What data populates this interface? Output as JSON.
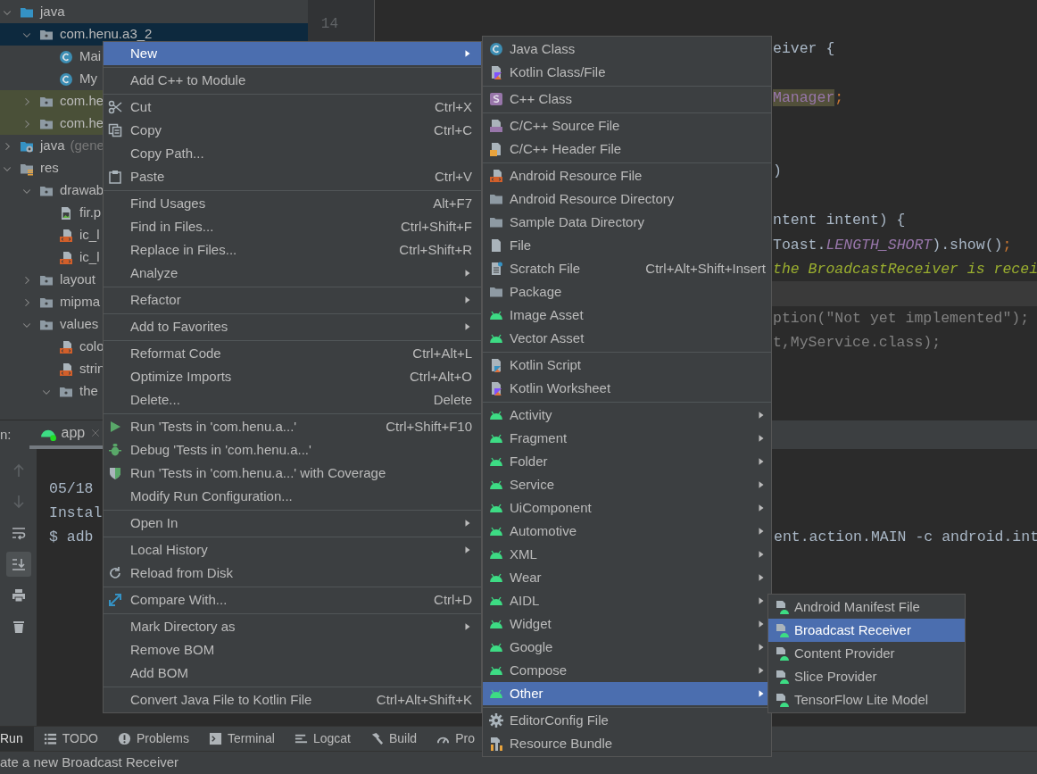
{
  "project_tree": {
    "items": [
      {
        "label": "java",
        "kind": "source-folder",
        "expanded": true,
        "selected": false,
        "tinted": false,
        "children": [
          {
            "label": "com.henu.a3_2",
            "kind": "package",
            "expanded": true,
            "selected": true,
            "tinted": false,
            "children": [
              {
                "label": "Mai",
                "kind": "class",
                "selected": false,
                "tinted": false
              },
              {
                "label": "My",
                "kind": "class",
                "selected": false,
                "tinted": false
              }
            ]
          },
          {
            "label": "com.he",
            "kind": "package",
            "expanded": false,
            "selected": false,
            "tinted": true
          },
          {
            "label": "com.he",
            "kind": "package",
            "expanded": false,
            "selected": false,
            "tinted": true
          }
        ]
      },
      {
        "label": "java",
        "note": "(gene",
        "kind": "generated-folder",
        "expanded": false,
        "selected": false,
        "tinted": false
      },
      {
        "label": "res",
        "kind": "res-folder",
        "expanded": true,
        "selected": false,
        "tinted": false,
        "children": [
          {
            "label": "drawab",
            "kind": "package",
            "expanded": true,
            "selected": false,
            "tinted": false,
            "children": [
              {
                "label": "fir.p",
                "kind": "image",
                "selected": false,
                "tinted": false
              },
              {
                "label": "ic_l",
                "kind": "xml",
                "selected": false,
                "tinted": false
              },
              {
                "label": "ic_l",
                "kind": "xml",
                "selected": false,
                "tinted": false
              }
            ]
          },
          {
            "label": "layout",
            "kind": "package",
            "expanded": false,
            "selected": false,
            "tinted": false
          },
          {
            "label": "mipma",
            "kind": "package",
            "expanded": false,
            "selected": false,
            "tinted": false
          },
          {
            "label": "values",
            "kind": "package",
            "expanded": true,
            "selected": false,
            "tinted": false,
            "children": [
              {
                "label": "colo",
                "kind": "xml",
                "selected": false,
                "tinted": false
              },
              {
                "label": "strin",
                "kind": "xml",
                "selected": false,
                "tinted": false
              },
              {
                "label": "the",
                "kind": "package",
                "expanded": true,
                "selected": false,
                "tinted": false
              }
            ]
          }
        ]
      }
    ]
  },
  "editor": {
    "lines": [
      {
        "number": "14",
        "current": false
      },
      {
        "current": false,
        "segments": [
          {
            "text": "eiver {",
            "kind": "plain"
          }
        ]
      },
      {
        "current": false
      },
      {
        "current": false,
        "segments": [
          {
            "text": "Manager",
            "kind": "marked"
          },
          {
            "text": ";",
            "kind": "keyword"
          }
        ]
      },
      {
        "current": false
      },
      {
        "current": false
      },
      {
        "current": false,
        "segments": [
          {
            "text": ")",
            "kind": "plain"
          }
        ]
      },
      {
        "current": false
      },
      {
        "current": false,
        "segments": [
          {
            "text": "ntent intent) {",
            "kind": "plain"
          }
        ]
      },
      {
        "current": false,
        "segments": [
          {
            "text": "Toast.",
            "kind": "plain"
          },
          {
            "text": "LENGTH_SHORT",
            "kind": "constant"
          },
          {
            "text": ").show()",
            "kind": "plain"
          },
          {
            "text": ";",
            "kind": "keyword"
          }
        ]
      },
      {
        "current": false,
        "segments": [
          {
            "text": "the BroadcastReceiver is recei",
            "kind": "comment"
          }
        ]
      },
      {
        "current": true
      },
      {
        "current": false,
        "segments": [
          {
            "text": "ption(\"Not yet implemented\");",
            "kind": "dim"
          }
        ]
      },
      {
        "current": false,
        "segments": [
          {
            "text": "t,MyService.class);",
            "kind": "dim"
          }
        ]
      }
    ]
  },
  "run_panel": {
    "title": "n:",
    "tabs": [
      {
        "label": "app",
        "selected": true
      }
    ],
    "toolbar": [
      {
        "kind": "up",
        "disabled": true,
        "selected": false
      },
      {
        "kind": "down",
        "disabled": true,
        "selected": false
      },
      {
        "kind": "wrap",
        "disabled": false,
        "selected": false
      },
      {
        "kind": "scroll-end",
        "disabled": false,
        "selected": true
      },
      {
        "kind": "print",
        "disabled": false,
        "selected": false
      },
      {
        "kind": "trash",
        "disabled": false,
        "selected": false
      }
    ],
    "console": [
      {
        "text": "05/18"
      },
      {
        "text": "Instal"
      },
      {
        "text": "$ adb",
        "tail": "ent.action.MAIN -c android.int"
      }
    ]
  },
  "tool_tabs": [
    {
      "label": "Run",
      "kind": "run",
      "selected": true
    },
    {
      "label": "TODO",
      "kind": "todo",
      "selected": false
    },
    {
      "label": "Problems",
      "kind": "problems",
      "selected": false
    },
    {
      "label": "Terminal",
      "kind": "terminal",
      "selected": false
    },
    {
      "label": "Logcat",
      "kind": "logcat",
      "selected": false
    },
    {
      "label": "Build",
      "kind": "build",
      "selected": false
    },
    {
      "label": "Pro",
      "kind": "profiler",
      "selected": false
    }
  ],
  "status_bar": {
    "text": "ate a new Broadcast Receiver"
  },
  "context_menu": {
    "items": [
      {
        "label": "New",
        "kind": "plain",
        "submenu": true,
        "selected": true
      },
      {
        "kind": "separator"
      },
      {
        "label": "Add C++ to Module",
        "kind": "plain",
        "submenu": false,
        "selected": false
      },
      {
        "kind": "separator"
      },
      {
        "label": "Cut",
        "kind": "cut",
        "shortcut": "Ctrl+X",
        "submenu": false,
        "selected": false
      },
      {
        "label": "Copy",
        "kind": "copy",
        "shortcut": "Ctrl+C",
        "submenu": false,
        "selected": false
      },
      {
        "label": "Copy Path...",
        "kind": "plain",
        "submenu": false,
        "selected": false
      },
      {
        "label": "Paste",
        "kind": "paste",
        "shortcut": "Ctrl+V",
        "submenu": false,
        "selected": false
      },
      {
        "kind": "separator"
      },
      {
        "label": "Find Usages",
        "kind": "plain",
        "shortcut": "Alt+F7",
        "submenu": false,
        "selected": false
      },
      {
        "label": "Find in Files...",
        "kind": "plain",
        "shortcut": "Ctrl+Shift+F",
        "submenu": false,
        "selected": false
      },
      {
        "label": "Replace in Files...",
        "kind": "plain",
        "shortcut": "Ctrl+Shift+R",
        "submenu": false,
        "selected": false
      },
      {
        "label": "Analyze",
        "kind": "plain",
        "submenu": true,
        "selected": false
      },
      {
        "kind": "separator"
      },
      {
        "label": "Refactor",
        "kind": "plain",
        "submenu": true,
        "selected": false
      },
      {
        "kind": "separator"
      },
      {
        "label": "Add to Favorites",
        "kind": "plain",
        "submenu": true,
        "selected": false
      },
      {
        "kind": "separator"
      },
      {
        "label": "Reformat Code",
        "kind": "plain",
        "shortcut": "Ctrl+Alt+L",
        "submenu": false,
        "selected": false
      },
      {
        "label": "Optimize Imports",
        "kind": "plain",
        "shortcut": "Ctrl+Alt+O",
        "submenu": false,
        "selected": false
      },
      {
        "label": "Delete...",
        "kind": "plain",
        "shortcut": "Delete",
        "submenu": false,
        "selected": false
      },
      {
        "kind": "separator"
      },
      {
        "label": "Run 'Tests in 'com.henu.a...'",
        "kind": "run",
        "shortcut": "Ctrl+Shift+F10",
        "submenu": false,
        "selected": false
      },
      {
        "label": "Debug 'Tests in 'com.henu.a...'",
        "kind": "debug",
        "submenu": false,
        "selected": false
      },
      {
        "label": "Run 'Tests in 'com.henu.a...' with Coverage",
        "kind": "coverage",
        "submenu": false,
        "selected": false
      },
      {
        "label": "Modify Run Configuration...",
        "kind": "plain",
        "submenu": false,
        "selected": false
      },
      {
        "kind": "separator"
      },
      {
        "label": "Open In",
        "kind": "plain",
        "submenu": true,
        "selected": false
      },
      {
        "kind": "separator"
      },
      {
        "label": "Local History",
        "kind": "plain",
        "submenu": true,
        "selected": false
      },
      {
        "label": "Reload from Disk",
        "kind": "reload",
        "submenu": false,
        "selected": false
      },
      {
        "kind": "separator"
      },
      {
        "label": "Compare With...",
        "kind": "compare",
        "shortcut": "Ctrl+D",
        "submenu": false,
        "selected": false
      },
      {
        "kind": "separator"
      },
      {
        "label": "Mark Directory as",
        "kind": "plain",
        "submenu": true,
        "selected": false
      },
      {
        "label": "Remove BOM",
        "kind": "plain",
        "submenu": false,
        "selected": false
      },
      {
        "label": "Add BOM",
        "kind": "plain",
        "submenu": false,
        "selected": false
      },
      {
        "kind": "separator"
      },
      {
        "label": "Convert Java File to Kotlin File",
        "kind": "plain",
        "shortcut": "Ctrl+Alt+Shift+K",
        "submenu": false,
        "selected": false
      }
    ]
  },
  "new_submenu": {
    "items": [
      {
        "label": "Java Class",
        "kind": "class",
        "submenu": false,
        "selected": false
      },
      {
        "label": "Kotlin Class/File",
        "kind": "kotlin",
        "submenu": false,
        "selected": false
      },
      {
        "kind": "separator"
      },
      {
        "label": "C++ Class",
        "kind": "cpp-class",
        "submenu": false,
        "selected": false
      },
      {
        "kind": "separator"
      },
      {
        "label": "C/C++ Source File",
        "kind": "cpp-source",
        "submenu": false,
        "selected": false
      },
      {
        "label": "C/C++ Header File",
        "kind": "cpp-header",
        "submenu": false,
        "selected": false
      },
      {
        "kind": "separator"
      },
      {
        "label": "Android Resource File",
        "kind": "xml",
        "submenu": false,
        "selected": false
      },
      {
        "label": "Android Resource Directory",
        "kind": "folder",
        "submenu": false,
        "selected": false
      },
      {
        "label": "Sample Data Directory",
        "kind": "folder",
        "submenu": false,
        "selected": false
      },
      {
        "label": "File",
        "kind": "file",
        "submenu": false,
        "selected": false
      },
      {
        "label": "Scratch File",
        "kind": "scratch",
        "shortcut": "Ctrl+Alt+Shift+Insert",
        "submenu": false,
        "selected": false
      },
      {
        "label": "Package",
        "kind": "folder",
        "submenu": false,
        "selected": false
      },
      {
        "label": "Image Asset",
        "kind": "android",
        "submenu": false,
        "selected": false
      },
      {
        "label": "Vector Asset",
        "kind": "android",
        "submenu": false,
        "selected": false
      },
      {
        "kind": "separator"
      },
      {
        "label": "Kotlin Script",
        "kind": "kotlin-script",
        "submenu": false,
        "selected": false
      },
      {
        "label": "Kotlin Worksheet",
        "kind": "kotlin",
        "submenu": false,
        "selected": false
      },
      {
        "kind": "separator"
      },
      {
        "label": "Activity",
        "kind": "android",
        "submenu": true,
        "selected": false
      },
      {
        "label": "Fragment",
        "kind": "android",
        "submenu": true,
        "selected": false
      },
      {
        "label": "Folder",
        "kind": "android",
        "submenu": true,
        "selected": false
      },
      {
        "label": "Service",
        "kind": "android",
        "submenu": true,
        "selected": false
      },
      {
        "label": "UiComponent",
        "kind": "android",
        "submenu": true,
        "selected": false
      },
      {
        "label": "Automotive",
        "kind": "android",
        "submenu": true,
        "selected": false
      },
      {
        "label": "XML",
        "kind": "android",
        "submenu": true,
        "selected": false
      },
      {
        "label": "Wear",
        "kind": "android",
        "submenu": true,
        "selected": false
      },
      {
        "label": "AIDL",
        "kind": "android",
        "submenu": true,
        "selected": false
      },
      {
        "label": "Widget",
        "kind": "android",
        "submenu": true,
        "selected": false
      },
      {
        "label": "Google",
        "kind": "android",
        "submenu": true,
        "selected": false
      },
      {
        "label": "Compose",
        "kind": "android",
        "submenu": true,
        "selected": false
      },
      {
        "label": "Other",
        "kind": "android",
        "submenu": true,
        "selected": true
      },
      {
        "kind": "separator"
      },
      {
        "label": "EditorConfig File",
        "kind": "gear",
        "submenu": false,
        "selected": false
      },
      {
        "label": "Resource Bundle",
        "kind": "bundle",
        "submenu": false,
        "selected": false
      }
    ]
  },
  "other_submenu": {
    "items": [
      {
        "label": "Android Manifest File",
        "kind": "android-file",
        "submenu": false,
        "selected": false
      },
      {
        "label": "Broadcast Receiver",
        "kind": "android-file",
        "submenu": false,
        "selected": true
      },
      {
        "label": "Content Provider",
        "kind": "android-file",
        "submenu": false,
        "selected": false
      },
      {
        "label": "Slice Provider",
        "kind": "android-file",
        "submenu": false,
        "selected": false
      },
      {
        "label": "TensorFlow Lite Model",
        "kind": "android-file",
        "submenu": false,
        "selected": false
      }
    ]
  }
}
